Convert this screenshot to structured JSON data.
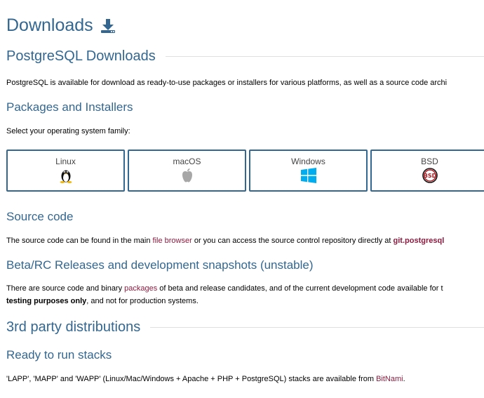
{
  "title": "Downloads",
  "sections": {
    "pg_downloads": {
      "heading": "PostgreSQL Downloads",
      "intro": "PostgreSQL is available for download as ready-to-use packages or installers for various platforms, as well as a source code archi"
    },
    "packages": {
      "heading": "Packages and Installers",
      "prompt": "Select your operating system family:",
      "os": [
        {
          "label": "Linux",
          "icon": "linux-tux-icon"
        },
        {
          "label": "macOS",
          "icon": "apple-icon"
        },
        {
          "label": "Windows",
          "icon": "windows-icon"
        },
        {
          "label": "BSD",
          "icon": "bsd-icon"
        }
      ]
    },
    "source": {
      "heading": "Source code",
      "text_before": "The source code can be found in the main ",
      "link1": "file browser",
      "text_middle": " or you can access the source control repository directly at ",
      "link2": "git.postgresql"
    },
    "beta": {
      "heading": "Beta/RC Releases and development snapshots (unstable)",
      "text_before": "There are source code and binary ",
      "link": "packages",
      "text_after": " of beta and release candidates, and of the current development code available for t",
      "bold": "testing purposes only",
      "text_end": ", and not for production systems."
    },
    "third_party": {
      "heading": "3rd party distributions"
    },
    "stacks": {
      "heading": "Ready to run stacks",
      "text": "'LAPP', 'MAPP' and 'WAPP' (Linux/Mac/Windows + Apache + PHP + PostgreSQL) stacks are available from ",
      "link": "BitNami",
      "text_end": "."
    }
  },
  "colors": {
    "heading": "#336791",
    "link": "#8b1c3f",
    "border": "#336791",
    "windows": "#00adef",
    "bsd": "#b0161c"
  }
}
